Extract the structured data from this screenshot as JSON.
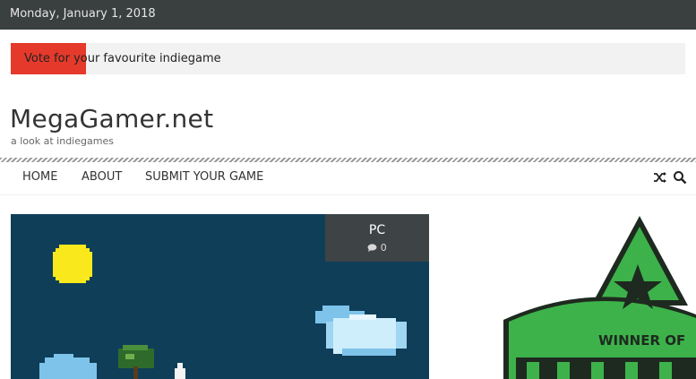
{
  "topbar": {
    "date": "Monday, January 1, 2018"
  },
  "ticker": {
    "text": "Vote for your favourite indiegame"
  },
  "site": {
    "title": "MegaGamer.net",
    "tagline": "a look at indiegames"
  },
  "nav": {
    "items": [
      {
        "label": "HOME"
      },
      {
        "label": "ABOUT"
      },
      {
        "label": "SUBMIT YOUR GAME"
      }
    ],
    "icons": [
      "shuffle-icon",
      "search-icon"
    ]
  },
  "feature": {
    "category": "PC",
    "comment_count": "0",
    "icons": [
      "comment-icon"
    ]
  },
  "sidebar_ad": {
    "text": "WINNER OF",
    "colors": {
      "green": "#3db24a",
      "dark": "#1e2a1f"
    }
  },
  "colors": {
    "topbar": "#3a3f40",
    "accent_red": "#e53a2b",
    "feature_bg": "#0f3e59"
  }
}
